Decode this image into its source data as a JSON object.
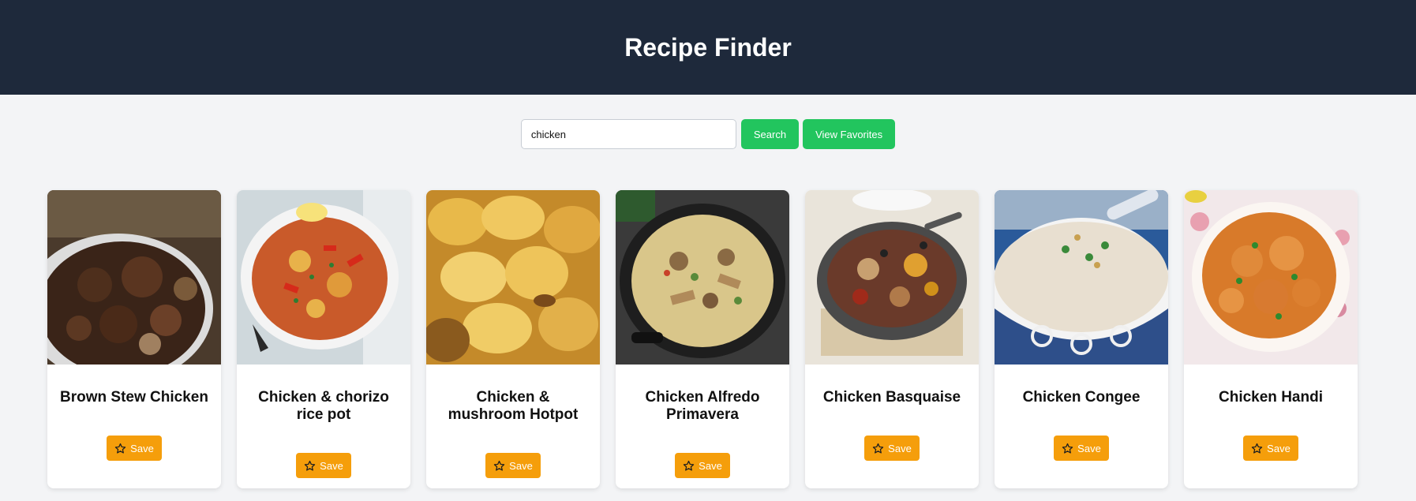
{
  "header": {
    "title": "Recipe Finder"
  },
  "search": {
    "value": "chicken",
    "search_label": "Search",
    "favorites_label": "View Favorites"
  },
  "recipes": [
    {
      "title": "Brown Stew Chicken",
      "save_label": "Save",
      "image_icon": "food-photo"
    },
    {
      "title": "Chicken & chorizo rice pot",
      "save_label": "Save",
      "image_icon": "food-photo"
    },
    {
      "title": "Chicken & mushroom Hotpot",
      "save_label": "Save",
      "image_icon": "food-photo"
    },
    {
      "title": "Chicken Alfredo Primavera",
      "save_label": "Save",
      "image_icon": "food-photo"
    },
    {
      "title": "Chicken Basquaise",
      "save_label": "Save",
      "image_icon": "food-photo"
    },
    {
      "title": "Chicken Congee",
      "save_label": "Save",
      "image_icon": "food-photo"
    },
    {
      "title": "Chicken Handi",
      "save_label": "Save",
      "image_icon": "food-photo"
    }
  ],
  "colors": {
    "header_bg": "#1e293b",
    "page_bg": "#f3f4f6",
    "accent_green": "#22c55e",
    "accent_orange": "#f59e0b"
  }
}
